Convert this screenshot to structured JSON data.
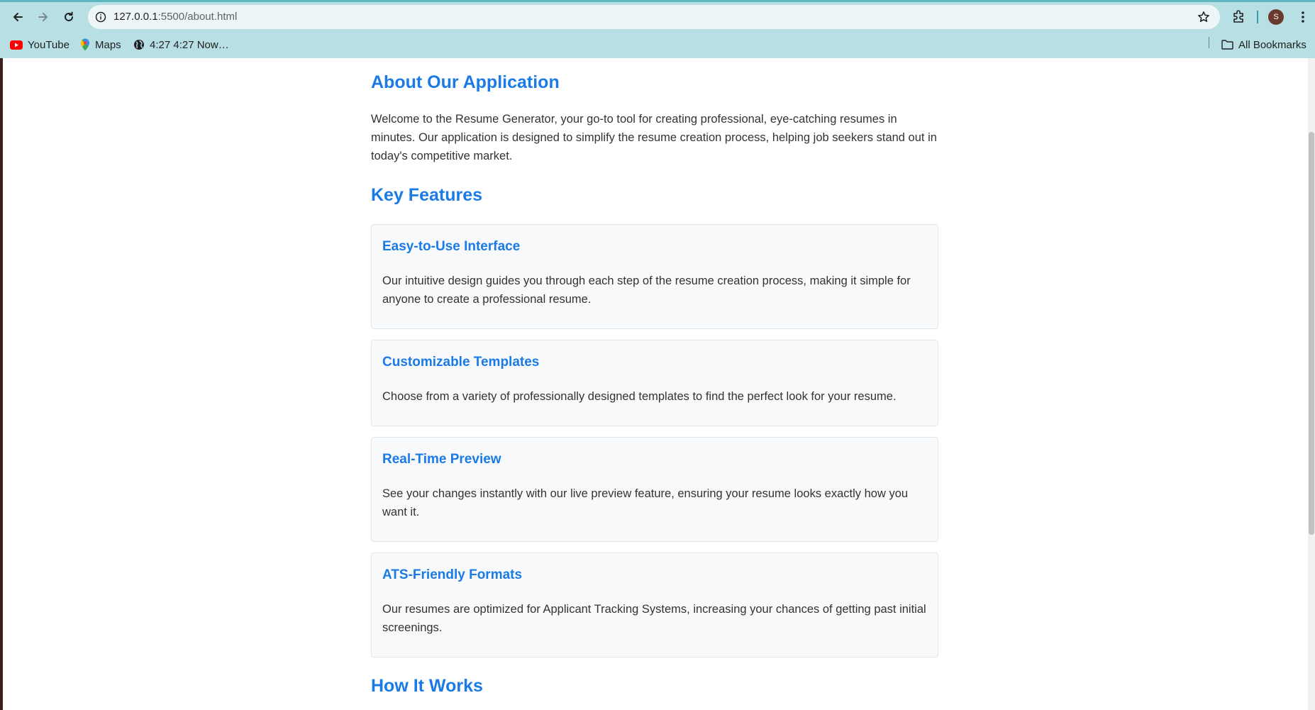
{
  "browser": {
    "url_host": "127.0.0.1",
    "url_path": ":5500/about.html",
    "avatar_letter": "S",
    "bookmarks": [
      {
        "label": "YouTube",
        "icon": "youtube-icon"
      },
      {
        "label": "Maps",
        "icon": "maps-pin-icon"
      },
      {
        "label": "4:27 4:27 Now…",
        "icon": "globe-icon"
      }
    ],
    "all_bookmarks_label": "All Bookmarks"
  },
  "page": {
    "title": "About Our Application",
    "intro": "Welcome to the Resume Generator, your go-to tool for creating professional, eye-catching resumes in minutes. Our application is designed to simplify the resume creation process, helping job seekers stand out in today's competitive market.",
    "features_heading": "Key Features",
    "features": [
      {
        "title": "Easy-to-Use Interface",
        "text": "Our intuitive design guides you through each step of the resume creation process, making it simple for anyone to create a professional resume."
      },
      {
        "title": "Customizable Templates",
        "text": "Choose from a variety of professionally designed templates to find the perfect look for your resume."
      },
      {
        "title": "Real-Time Preview",
        "text": "See your changes instantly with our live preview feature, ensuring your resume looks exactly how you want it."
      },
      {
        "title": "ATS-Friendly Formats",
        "text": "Our resumes are optimized for Applicant Tracking Systems, increasing your chances of getting past initial screenings."
      }
    ],
    "how_heading": "How It Works"
  },
  "colors": {
    "accent": "#1a7ae6",
    "chrome": "#b8dfe3"
  }
}
